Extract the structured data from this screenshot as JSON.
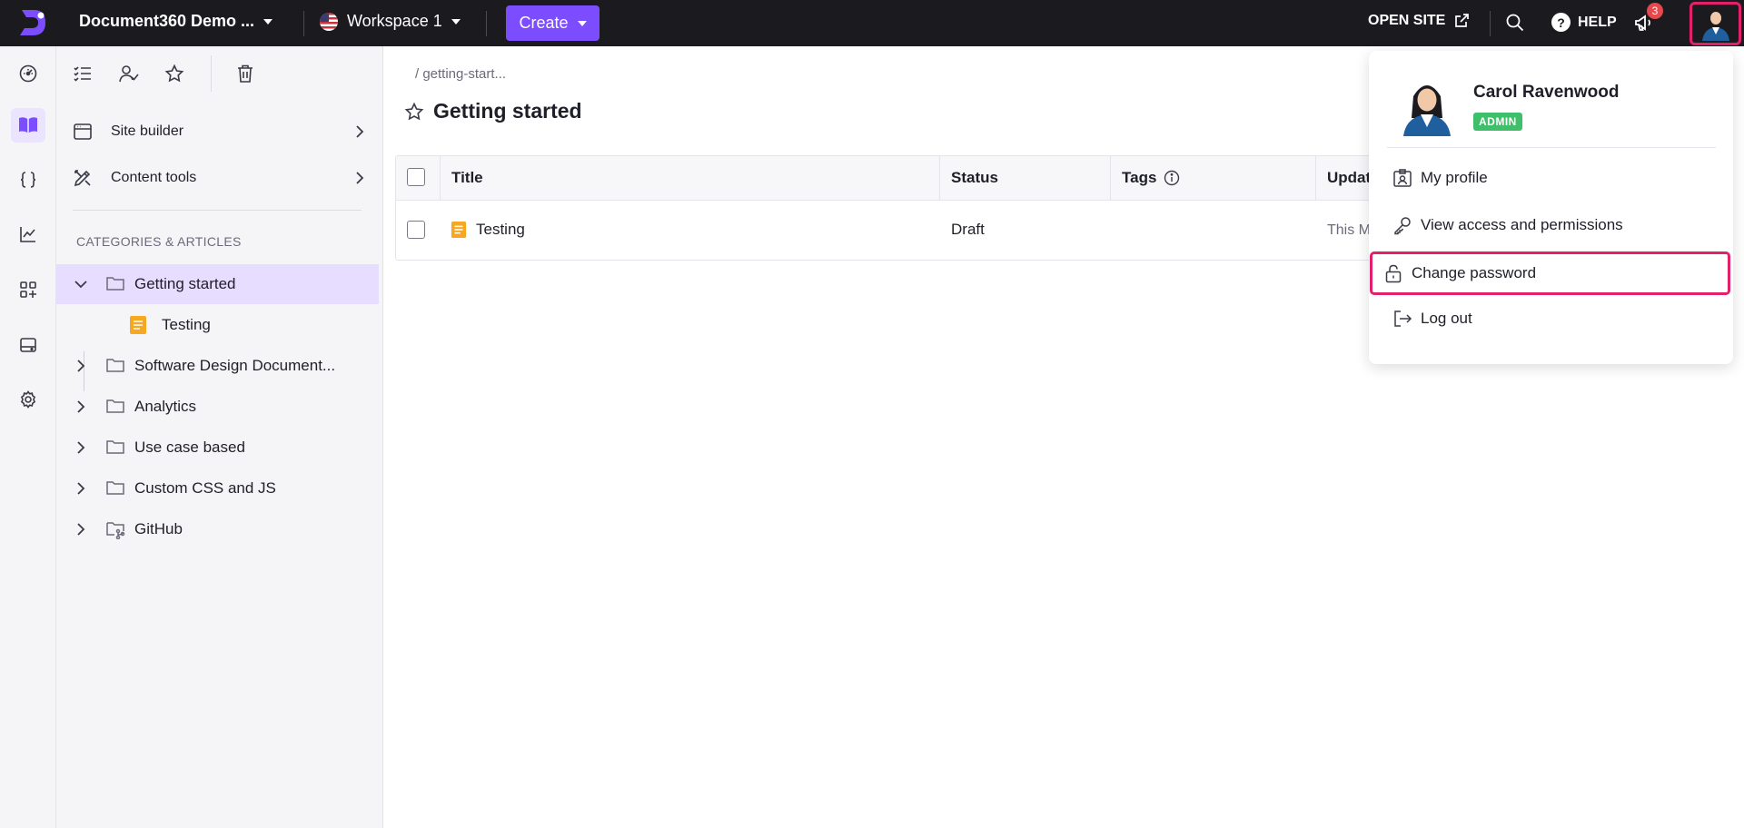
{
  "topbar": {
    "project_name": "Document360 Demo ...",
    "workspace_name": "Workspace 1",
    "create_label": "Create",
    "open_site_label": "OPEN SITE",
    "help_label": "HELP",
    "notification_count": "3"
  },
  "rail": {
    "items": [
      "dashboard-icon",
      "book-icon",
      "braces-icon",
      "analytics-icon",
      "apps-icon",
      "drive-icon",
      "gear-icon"
    ],
    "active": "book-icon"
  },
  "panel": {
    "nav": [
      {
        "label": "Site builder"
      },
      {
        "label": "Content tools"
      }
    ],
    "section_title": "CATEGORIES & ARTICLES",
    "tree": [
      {
        "label": "Getting started",
        "expanded": true,
        "selected": true
      },
      {
        "label": "Testing",
        "child": true
      },
      {
        "label": "Software Design Document..."
      },
      {
        "label": "Analytics"
      },
      {
        "label": "Use case based"
      },
      {
        "label": "Custom CSS and JS"
      },
      {
        "label": "GitHub"
      }
    ]
  },
  "main": {
    "breadcrumb": "/ getting-start...",
    "title": "Getting started",
    "columns": [
      "Title",
      "Status",
      "Tags",
      "Updat"
    ],
    "rows": [
      {
        "title": "Testing",
        "status": "Draft",
        "updated": "This M"
      }
    ]
  },
  "profile_menu": {
    "name": "Carol Ravenwood",
    "role": "ADMIN",
    "items": [
      {
        "label": "My profile",
        "icon": "id-badge-icon"
      },
      {
        "label": "View access and permissions",
        "icon": "key-icon"
      },
      {
        "label": "Change password",
        "icon": "lock-icon",
        "highlighted": true
      },
      {
        "label": "Log out",
        "icon": "logout-icon"
      }
    ]
  },
  "colors": {
    "accent": "#7c4dff",
    "topbar_bg": "#1b1b1f",
    "highlight": "#e3206b",
    "admin_badge": "#3fbf6a",
    "selected_row": "#e6ddff"
  }
}
